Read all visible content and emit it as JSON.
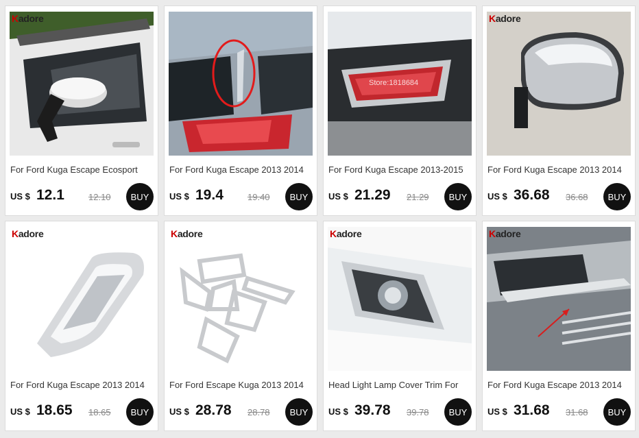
{
  "currency": "US $",
  "buy_label": "BUY",
  "products": [
    {
      "title": "For Ford Kuga Escape Ecosport",
      "price": "12.1",
      "old_price": "12.10",
      "brand": "Kadore",
      "photo": "side-mirror-window-visor"
    },
    {
      "title": "For Ford Kuga Escape 2013 2014",
      "price": "19.4",
      "old_price": "19.40",
      "brand": "",
      "photo": "rear-pillar-trim"
    },
    {
      "title": "For Ford Kuga Escape 2013-2015",
      "price": "21.29",
      "old_price": "21.29",
      "brand": "",
      "photo": "rear-fog-lamp-cover",
      "watermark": "Store:1818684"
    },
    {
      "title": "For Ford Kuga Escape 2013 2014",
      "price": "36.68",
      "old_price": "36.68",
      "brand": "Kadore",
      "photo": "chrome-mirror-cover"
    },
    {
      "title": "For Ford Kuga Escape 2013 2014",
      "price": "18.65",
      "old_price": "18.65",
      "brand": "Kadore",
      "photo": "chrome-frame-trim"
    },
    {
      "title": "For Ford Escape Kuga 2013 2014",
      "price": "28.78",
      "old_price": "28.78",
      "brand": "Kadore",
      "photo": "lamp-trim-set"
    },
    {
      "title": "Head Light Lamp Cover Trim For",
      "price": "39.78",
      "old_price": "39.78",
      "brand": "Kadore",
      "photo": "headlight-cover-trim"
    },
    {
      "title": "For Ford Kuga Escape 2013 2014",
      "price": "31.68",
      "old_price": "31.68",
      "brand": "Kadore",
      "photo": "front-grille-trim"
    }
  ]
}
